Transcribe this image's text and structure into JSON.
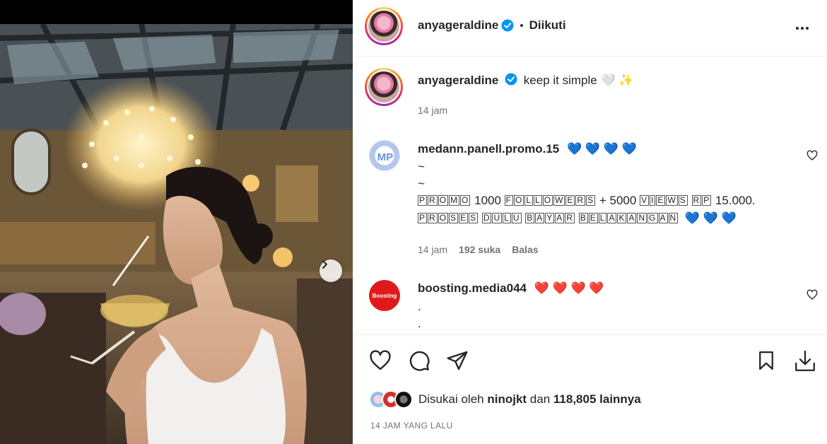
{
  "post": {
    "author": "anyageraldine",
    "follow_status": "Diikuti",
    "dot": "•",
    "caption": "keep it simple 🤍 ✨",
    "caption_time": "14 jam"
  },
  "comments": [
    {
      "user": "medann.panell.promo.15",
      "hearts": "💙 💙 💙 💙",
      "line1": "~",
      "line2": "~",
      "promo_word": "PROMO",
      "promo_mid1": "1000",
      "followers_word": "FOLLOWERS",
      "promo_mid2": "+ 5000",
      "views_word": "VIEWS",
      "rp_word": "RP",
      "price": "15.000.",
      "proses_word": "PROSES",
      "dulu_word": "DULU",
      "bayar_word": "BAYAR",
      "belakangan_word": "BELAKANGAN",
      "tail_hearts": "💙 💙 💙",
      "time": "14 jam",
      "likes": "192 suka",
      "reply": "Balas"
    },
    {
      "user": "boosting.media044",
      "hearts": "❤️ ❤️ ❤️ ❤️",
      "line1": ".",
      "line2": ".",
      "avatar_text": "Boosting"
    }
  ],
  "likes": {
    "prefix": "Disukai oleh",
    "user": "nino​jkt",
    "joiner": "dan",
    "count": "118,805 lainnya"
  },
  "posted_ago": "14 JAM YANG LALU",
  "icons": {
    "verified": "verified-badge-icon",
    "more": "more-options-icon",
    "like": "heart-icon",
    "comment": "comment-icon",
    "share": "share-icon",
    "save": "bookmark-icon",
    "download": "download-icon",
    "next": "chevron-right-icon"
  },
  "colors": {
    "verified_blue": "#0095f6",
    "text": "#262626",
    "muted": "#737373",
    "border": "#efefef"
  }
}
